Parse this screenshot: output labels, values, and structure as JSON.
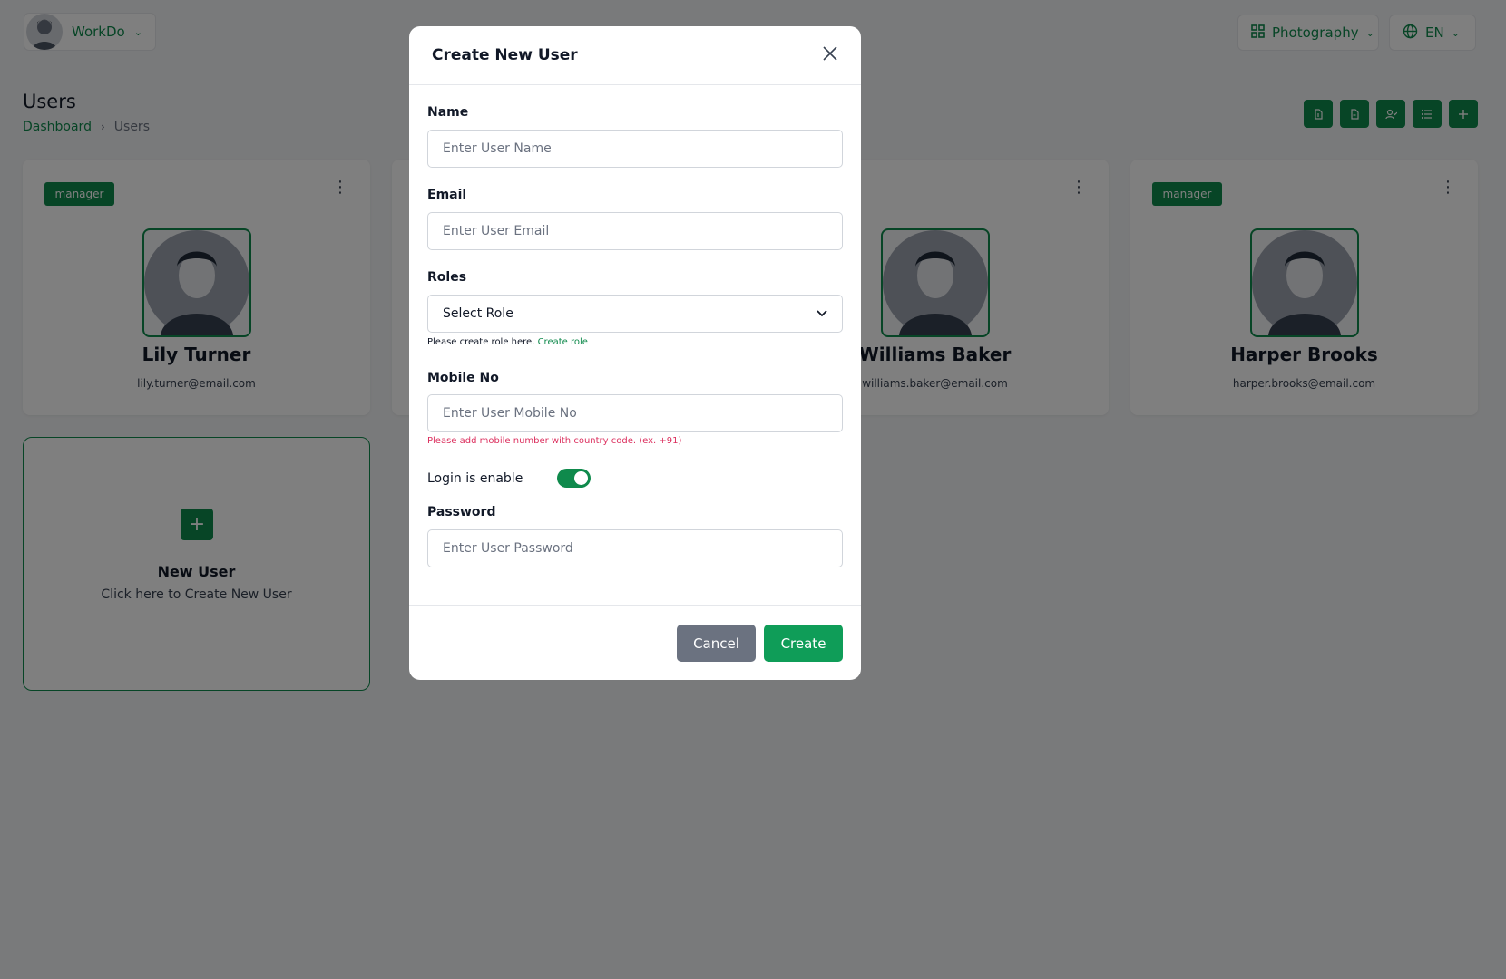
{
  "header": {
    "workspace_name": "WorkDo",
    "category_label": "Photography",
    "language_label": "EN"
  },
  "page": {
    "title": "Users",
    "breadcrumb": [
      "Dashboard",
      "Users"
    ]
  },
  "toolbar": {
    "icons": [
      "file-export-icon",
      "file-import-icon",
      "user-check-icon",
      "list-icon",
      "plus-icon"
    ]
  },
  "users": [
    {
      "role": "manager",
      "name": "Lily Turner",
      "email": "lily.turner@email.com"
    },
    {
      "role": "",
      "name": "",
      "email": ""
    },
    {
      "role": "",
      "name": "Williams Baker",
      "email": "williams.baker@email.com"
    },
    {
      "role": "manager",
      "name": "Harper Brooks",
      "email": "harper.brooks@email.com"
    }
  ],
  "new_user_card": {
    "title": "New User",
    "subtitle": "Click here to Create New User"
  },
  "modal": {
    "title": "Create New User",
    "name": {
      "label": "Name",
      "placeholder": "Enter User Name"
    },
    "email": {
      "label": "Email",
      "placeholder": "Enter User Email"
    },
    "roles": {
      "label": "Roles",
      "selected": "Select Role",
      "helper_text": "Please create role here.",
      "helper_link": "Create role"
    },
    "mobile": {
      "label": "Mobile No",
      "placeholder": "Enter User Mobile No",
      "helper": "Please add mobile number with country code. (ex. +91)"
    },
    "login": {
      "label": "Login is enable",
      "enabled": true
    },
    "password": {
      "label": "Password",
      "placeholder": "Enter User Password"
    },
    "cancel_label": "Cancel",
    "create_label": "Create"
  },
  "colors": {
    "primary": "#0f8a4c",
    "create_button": "#0f9d58",
    "cancel_button": "#6b7280",
    "danger": "#dc2f5e"
  }
}
